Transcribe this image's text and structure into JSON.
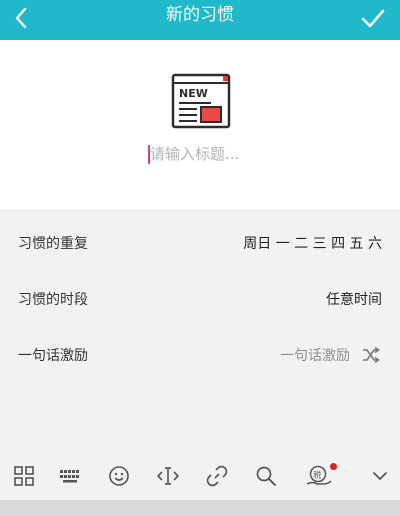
{
  "header": {
    "title": "新的习惯",
    "background": "#1fb9c9"
  },
  "hero": {
    "icon": "news-icon",
    "icon_badge_text": "NEW",
    "title_input_placeholder": "请输入标题..."
  },
  "rows": [
    {
      "label": "习惯的重复",
      "value": "周日 一 二 三 四 五 六"
    },
    {
      "label": "习惯的时段",
      "value": "任意时间"
    },
    {
      "label": "一句话激励",
      "value": "一句话激励",
      "trailing_icon": "shuffle-icon"
    }
  ],
  "toolbar": {
    "icons": [
      "grid-icon",
      "keyboard-icon",
      "emoji-icon",
      "text-cursor-icon",
      "link-icon",
      "search-icon",
      "tax-hand-icon",
      "chevron-down-icon"
    ],
    "tax_badge": "税",
    "notification_color": "#e02020"
  }
}
